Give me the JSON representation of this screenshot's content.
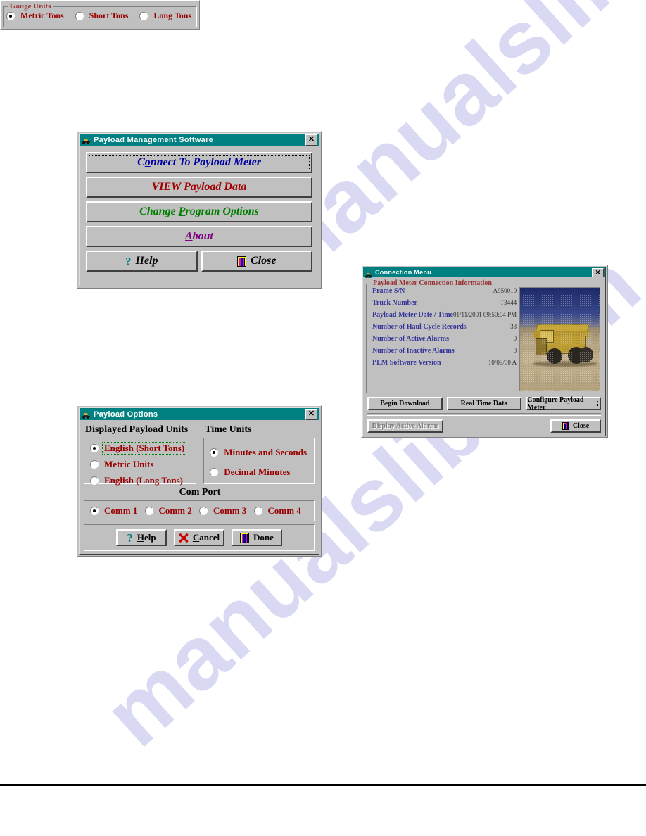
{
  "page": {
    "watermark_line1": "m",
    "watermark_line2": "manualslib.com"
  },
  "main_window": {
    "title": "Payload Management Software",
    "close_label": "✕",
    "icon": "app-truck-icon",
    "buttons": [
      {
        "text": "Connect To Payload Meter",
        "accel": "o",
        "color": "c-blue",
        "focused": true
      },
      {
        "text": "VIEW Payload Data",
        "accel": "V",
        "color": "c-red",
        "focused": false
      },
      {
        "text": "Change Program Options",
        "accel": "P",
        "color": "c-green",
        "focused": false
      },
      {
        "text": "About",
        "accel": "A",
        "color": "c-purple",
        "focused": false
      }
    ],
    "help_label": "Help",
    "close_button_label": "Close"
  },
  "options_window": {
    "title": "Payload Options",
    "close_label": "✕",
    "group_payload_units": "Displayed Payload Units",
    "group_time_units": "Time Units",
    "group_com_port": "Com Port",
    "payload_units": [
      {
        "label": "English (Short Tons)",
        "selected": true,
        "focused": true
      },
      {
        "label": "Metric Units",
        "selected": false,
        "focused": false
      },
      {
        "label": "English (Long Tons)",
        "selected": false,
        "focused": false
      }
    ],
    "time_units": [
      {
        "label": "Minutes and Seconds",
        "selected": true
      },
      {
        "label": "Decimal Minutes",
        "selected": false
      }
    ],
    "com_ports": [
      {
        "label": "Comm 1",
        "selected": true
      },
      {
        "label": "Comm 2",
        "selected": false
      },
      {
        "label": "Comm 3",
        "selected": false
      },
      {
        "label": "Comm 4",
        "selected": false
      }
    ],
    "help_label": "Help",
    "cancel_label": "Cancel",
    "done_label": "Done"
  },
  "connection_window": {
    "title": "Connection Menu",
    "close_label": "✕",
    "group_title": "Payload Meter Connection Information",
    "info": [
      {
        "label": "Frame S/N",
        "value": "A950010"
      },
      {
        "label": "Truck Number",
        "value": "T3444"
      },
      {
        "label": "Payload Meter Date / Time",
        "value": "01/11/2001 09:50:04 PM"
      },
      {
        "label": "Number of Haul Cycle Records",
        "value": "33"
      },
      {
        "label": "Number of Active Alarms",
        "value": "0"
      },
      {
        "label": "Number of Inactive Alarms",
        "value": "0"
      },
      {
        "label": "PLM Software Version",
        "value": "10/09/00 A"
      }
    ],
    "image_caption": "mining haul truck photo",
    "btn_begin_download": "Begin Download",
    "btn_real_time_data": "Real Time Data",
    "btn_configure": "Configure Payload Meter",
    "btn_display_alarms": "Display Active Alarms",
    "btn_close": "Close"
  },
  "gauge_window": {
    "group_title": "Gauge Units",
    "options": [
      {
        "label": "Metric Tons",
        "selected": true
      },
      {
        "label": "Short Tons",
        "selected": false
      },
      {
        "label": "Long Tons",
        "selected": false
      }
    ]
  },
  "colors": {
    "titlebar": "#008080",
    "face": "#c0c0c0",
    "accent_blue": "#0000a0",
    "accent_red": "#a00000",
    "accent_green": "#008000",
    "accent_purple": "#800080",
    "label_red": "#990000",
    "label_blue": "#333399",
    "watermark": "#cdcdf0"
  }
}
